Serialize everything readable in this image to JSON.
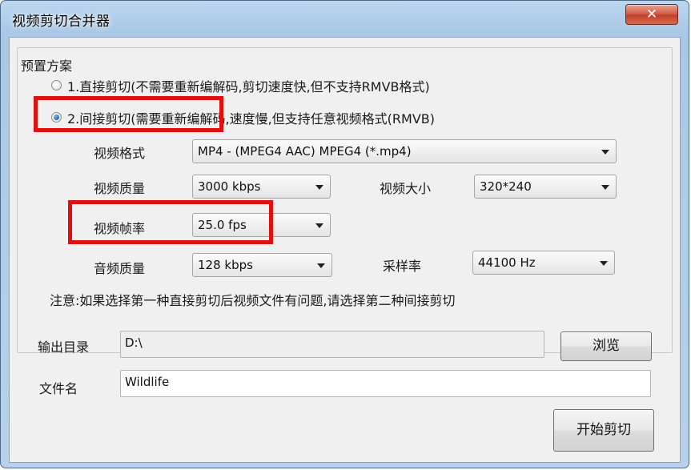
{
  "window": {
    "title": "视频剪切合并器",
    "close_glyph": "✕"
  },
  "preset": {
    "group_label": "预置方案",
    "option1": "1.直接剪切(不需要重新编解码,剪切速度快,但不支持RMVB格式)",
    "option2": "2.间接剪切(需要重新编解码,速度慢,但支持任意视频格式(RMVB)",
    "selected": 2
  },
  "video_format": {
    "label": "视频格式",
    "value": "MP4 - (MPEG4 AAC) MPEG4 (*.mp4)"
  },
  "video_quality": {
    "label": "视频质量",
    "value": "3000 kbps"
  },
  "video_size": {
    "label": "视频大小",
    "value": "320*240"
  },
  "frame_rate": {
    "label": "视频帧率",
    "value": "25.0 fps"
  },
  "audio_quality": {
    "label": "音频质量",
    "value": "128 kbps"
  },
  "sample_rate": {
    "label": "采样率",
    "value": "44100 Hz"
  },
  "note": "注意:如果选择第一种直接剪切后视频文件有问题,请选择第二种间接剪切",
  "output": {
    "dir_label": "输出目录",
    "dir_value": "D:\\",
    "browse_label": "浏览",
    "filename_label": "文件名",
    "filename_value": "Wildlife"
  },
  "start_label": "开始剪切",
  "colors": {
    "highlight": "#e01010",
    "title_bar": "#a9c8e6",
    "close_button": "#c2402a",
    "client_bg": "#f0f0f0"
  }
}
